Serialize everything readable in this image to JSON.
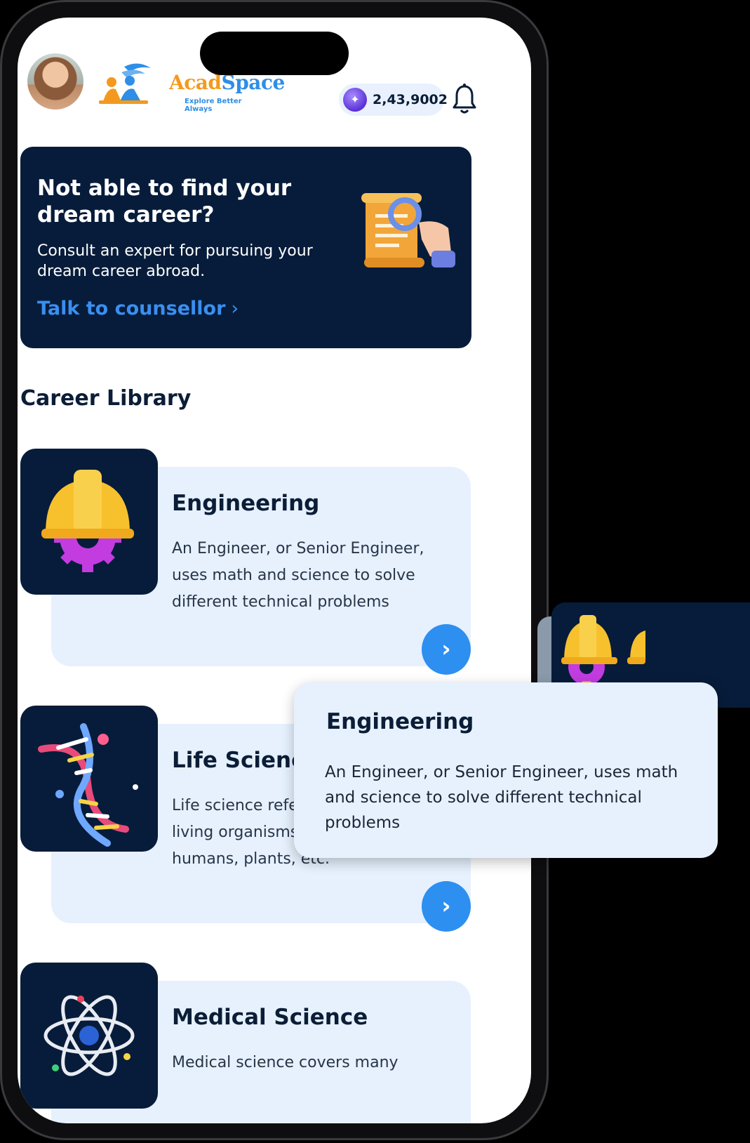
{
  "header": {
    "logo_name_part1": "Acad",
    "logo_name_part2": "Space",
    "logo_tagline": "Explore Better Always",
    "coins_value": "2,43,9002"
  },
  "banner": {
    "title": "Not able to find your dream career?",
    "subtitle": "Consult an expert for pursuing your dream career abroad.",
    "link_label": "Talk to counsellor",
    "link_chevron": "›"
  },
  "section_title": "Career Library",
  "careers": [
    {
      "title": "Engineering",
      "description": "An Engineer, or Senior Engineer, uses math and science to solve different technical problems",
      "icon": "hard-hat-gear-icon",
      "arrow": "›"
    },
    {
      "title": "Life Science",
      "description": "Life science refers to the study of living organisms such as microbes, humans, plants, etc.",
      "icon": "dna-icon",
      "arrow": "›"
    },
    {
      "title": "Medical Science",
      "description": "Medical science covers many",
      "icon": "atom-icon"
    }
  ],
  "popup": {
    "title": "Engineering",
    "description": "An Engineer, or Senior Engineer, uses math and science to solve different technical problems"
  },
  "colors": {
    "navy": "#071c3a",
    "accent_blue": "#2d8ff0",
    "card_bg": "#e6f1fd",
    "logo_orange": "#f39a1e"
  }
}
